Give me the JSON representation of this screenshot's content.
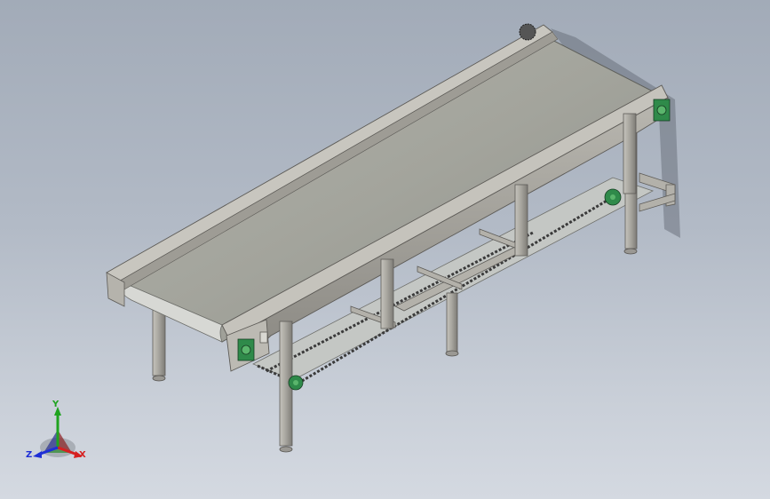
{
  "viewport": {
    "background_top": "#a2abb8",
    "background_bottom": "#d4d9e1"
  },
  "model": {
    "name": "belt-conveyor",
    "frame_color": "#a8a59e",
    "belt_color": "#a4a59d",
    "bearing_color": "#2f8a4a",
    "chain_color": "#3c3c3c"
  },
  "triad": {
    "x_label": "X",
    "y_label": "Y",
    "z_label": "Z",
    "x_color": "#d62020",
    "y_color": "#1fa31f",
    "z_color": "#1f2fd6"
  }
}
